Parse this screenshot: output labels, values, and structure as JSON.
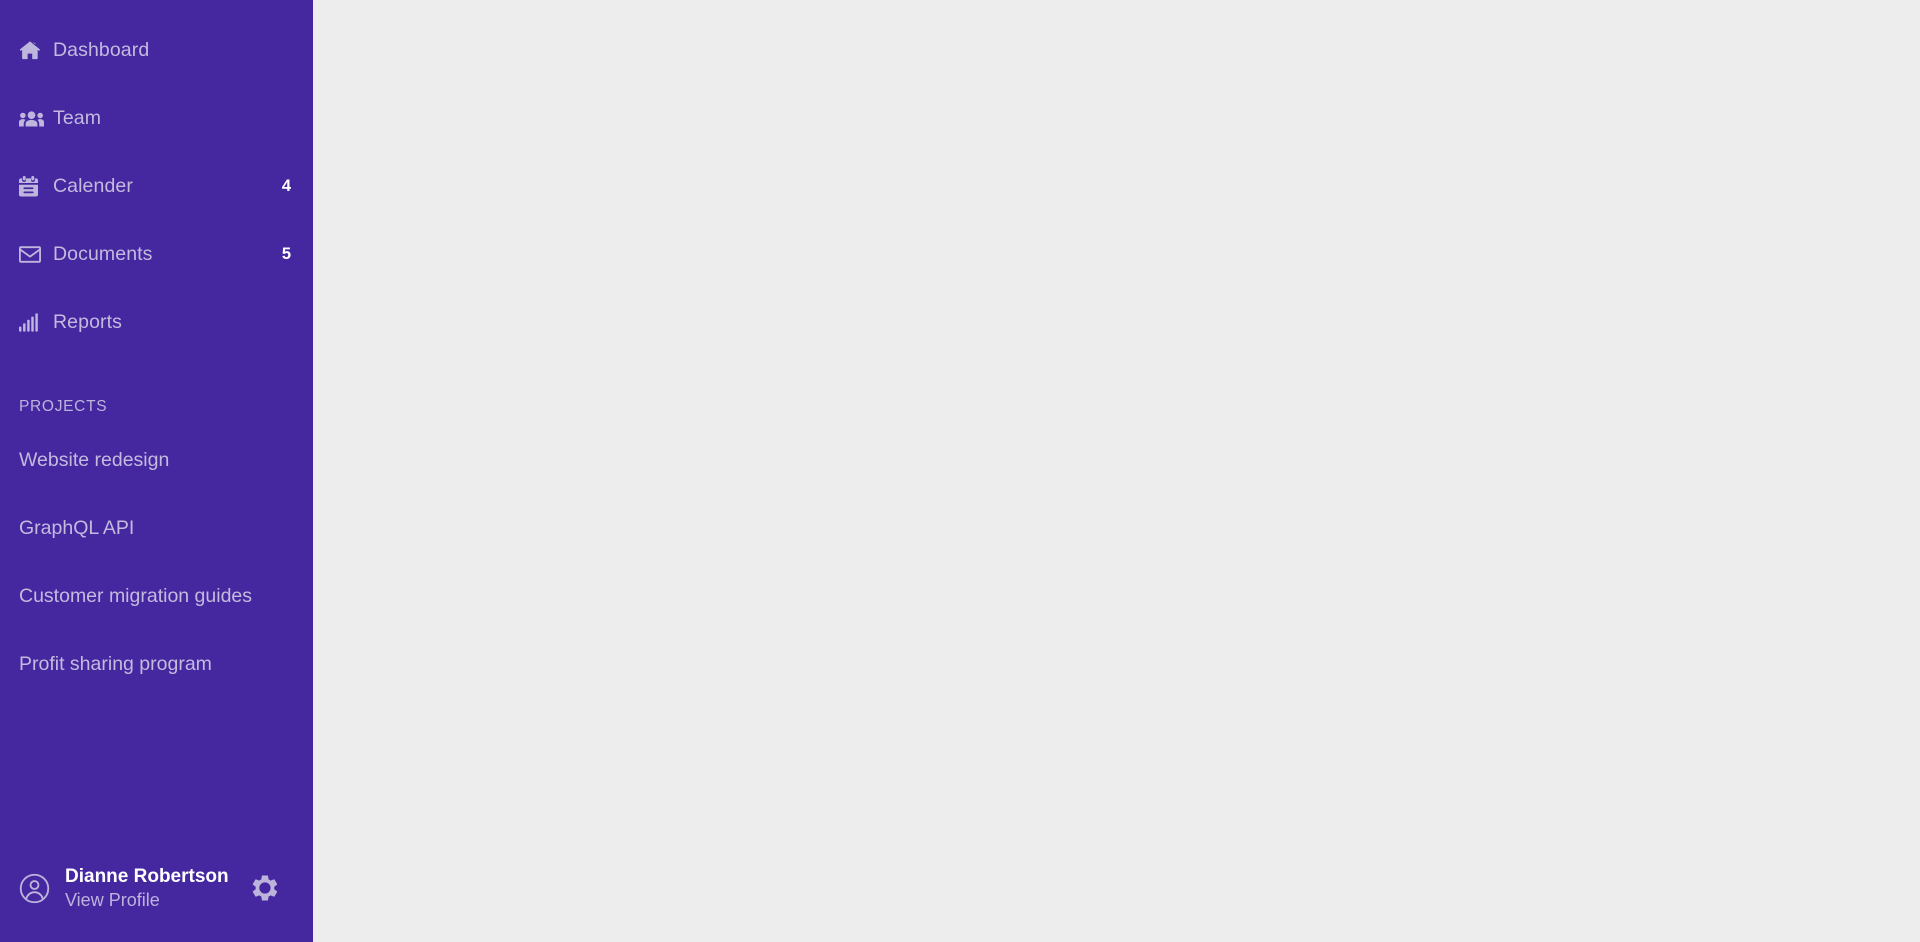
{
  "sidebar": {
    "background_color": "#4527a0",
    "text_color": "#c3bade",
    "nav_items": [
      {
        "label": "Dashboard",
        "icon": "home-icon",
        "badge": ""
      },
      {
        "label": "Team",
        "icon": "users-icon",
        "badge": ""
      },
      {
        "label": "Calender",
        "icon": "calendar-icon",
        "badge": "4"
      },
      {
        "label": "Documents",
        "icon": "envelope-icon",
        "badge": "5"
      },
      {
        "label": "Reports",
        "icon": "signal-bars-icon",
        "badge": ""
      }
    ],
    "projects": {
      "heading": "PROJECTS",
      "items": [
        {
          "label": "Website redesign"
        },
        {
          "label": "GraphQL API"
        },
        {
          "label": "Customer migration guides"
        },
        {
          "label": "Profit sharing program"
        }
      ]
    },
    "profile": {
      "avatar_icon": "user-circle-icon",
      "name": "Dianne Robertson",
      "link_label": "View Profile",
      "settings_icon": "gear-icon"
    }
  },
  "main": {
    "background_color": "#ededed",
    "content": ""
  }
}
